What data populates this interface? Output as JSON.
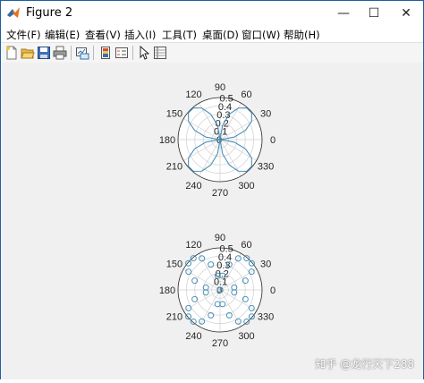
{
  "window": {
    "title": "Figure 2",
    "controls": {
      "minimize": "—",
      "maximize": "☐",
      "close": "✕"
    }
  },
  "menu": [
    {
      "label": "文件(F)"
    },
    {
      "label": "编辑(E)"
    },
    {
      "label": "查看(V)"
    },
    {
      "label": "插入(I)"
    },
    {
      "label": "工具(T)"
    },
    {
      "label": "桌面(D)"
    },
    {
      "label": "窗口(W)"
    },
    {
      "label": "帮助(H)"
    }
  ],
  "toolbar": [
    {
      "icon": "new-figure-icon"
    },
    {
      "icon": "open-file-icon"
    },
    {
      "icon": "save-icon"
    },
    {
      "icon": "print-icon"
    },
    {
      "icon": "link-plot-icon"
    },
    {
      "icon": "colorbar-icon"
    },
    {
      "icon": "legend-icon"
    },
    {
      "icon": "pointer-icon"
    },
    {
      "icon": "property-inspector-icon"
    }
  ],
  "colors": {
    "series": "#4a90b8",
    "grid": "#cfcfcf",
    "axis": "#262626",
    "background": "#f0f0f0",
    "plot_bg": "#ffffff"
  },
  "watermark": "知乎 @龙行天下288",
  "chart_data": [
    {
      "type": "line",
      "coordinate_system": "polar",
      "series": [
        {
          "expression": "r = 0.5*|sin(2θ)|",
          "theta_deg": [
            0,
            10,
            20,
            30,
            40,
            50,
            60,
            70,
            80,
            90,
            100,
            110,
            120,
            130,
            140,
            150,
            160,
            170,
            180,
            190,
            200,
            210,
            220,
            230,
            240,
            250,
            260,
            270,
            280,
            290,
            300,
            310,
            320,
            330,
            340,
            350,
            360
          ],
          "r": [
            0,
            0.171,
            0.321,
            0.433,
            0.492,
            0.492,
            0.433,
            0.321,
            0.171,
            0,
            0.171,
            0.321,
            0.433,
            0.492,
            0.492,
            0.433,
            0.321,
            0.171,
            0,
            0.171,
            0.321,
            0.433,
            0.492,
            0.492,
            0.433,
            0.321,
            0.171,
            0,
            0.171,
            0.321,
            0.433,
            0.492,
            0.492,
            0.433,
            0.321,
            0.171,
            0
          ]
        }
      ],
      "rlim": [
        0,
        0.5
      ],
      "r_ticks": [
        "0",
        "0.1",
        "0.2",
        "0.3",
        "0.4",
        "0.5"
      ],
      "theta_ticks": [
        "0",
        "30",
        "60",
        "90",
        "120",
        "150",
        "180",
        "210",
        "240",
        "270",
        "300",
        "330"
      ],
      "grid": true
    },
    {
      "type": "scatter",
      "coordinate_system": "polar",
      "marker": "circle",
      "series": [
        {
          "expression": "r = 0.5*|sin(2θ)|",
          "theta_deg": [
            0,
            10,
            20,
            30,
            40,
            50,
            60,
            70,
            80,
            90,
            100,
            110,
            120,
            130,
            140,
            150,
            160,
            170,
            180,
            190,
            200,
            210,
            220,
            230,
            240,
            250,
            260,
            270,
            280,
            290,
            300,
            310,
            320,
            330,
            340,
            350
          ],
          "r": [
            0,
            0.171,
            0.321,
            0.433,
            0.492,
            0.492,
            0.433,
            0.321,
            0.171,
            0,
            0.171,
            0.321,
            0.433,
            0.492,
            0.492,
            0.433,
            0.321,
            0.171,
            0,
            0.171,
            0.321,
            0.433,
            0.492,
            0.492,
            0.433,
            0.321,
            0.171,
            0,
            0.171,
            0.321,
            0.433,
            0.492,
            0.492,
            0.433,
            0.321,
            0.171
          ]
        }
      ],
      "rlim": [
        0,
        0.5
      ],
      "r_ticks": [
        "0",
        "0.1",
        "0.2",
        "0.3",
        "0.4",
        "0.5"
      ],
      "theta_ticks": [
        "0",
        "30",
        "60",
        "90",
        "120",
        "150",
        "180",
        "210",
        "240",
        "270",
        "300",
        "330"
      ],
      "grid": true
    }
  ]
}
